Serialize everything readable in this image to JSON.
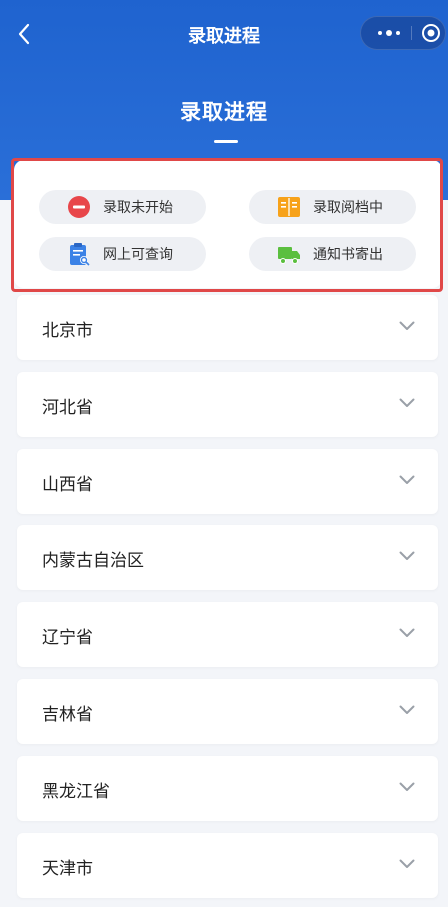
{
  "nav": {
    "title": "录取进程",
    "back_icon": "chevron-left-icon",
    "more_icon": "more-dots-icon",
    "target_icon": "target-icon"
  },
  "page": {
    "title": "录取进程"
  },
  "legend": [
    {
      "label": "录取未开始",
      "icon": "minus-circle-icon",
      "color": "#e8464a"
    },
    {
      "label": "录取阅档中",
      "icon": "open-book-icon",
      "color": "#f7a21a"
    },
    {
      "label": "网上可查询",
      "icon": "clipboard-search-icon",
      "color": "#3b82e6"
    },
    {
      "label": "通知书寄出",
      "icon": "truck-icon",
      "color": "#5bbf3f"
    }
  ],
  "regions": [
    {
      "name": "北京市"
    },
    {
      "name": "河北省"
    },
    {
      "name": "山西省"
    },
    {
      "name": "内蒙古自治区"
    },
    {
      "name": "辽宁省"
    },
    {
      "name": "吉林省"
    },
    {
      "name": "黑龙江省"
    },
    {
      "name": "天津市"
    }
  ],
  "colors": {
    "header": "#1f63cf",
    "background": "#f3f5f9",
    "highlight_border": "#e04848"
  }
}
